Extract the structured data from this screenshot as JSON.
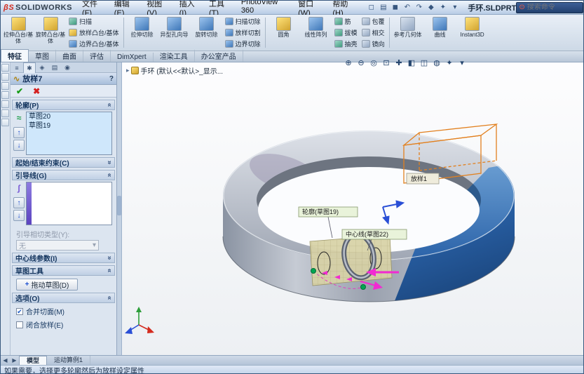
{
  "titlebar": {
    "logo": "SOLIDWORKS",
    "menus": [
      "文件(F)",
      "编辑(E)",
      "视图(V)",
      "插入(I)",
      "工具(T)",
      "PhotoView 360",
      "窗口(W)",
      "帮助(H)"
    ],
    "doc_title": "手环.SLDPRT",
    "search_placeholder": "搜索命令"
  },
  "ribbon": {
    "group1_large": [
      "拉伸凸台/基体",
      "旋转凸台/基体"
    ],
    "group1_stack": [
      "扫描",
      "放样凸台/基体",
      "边界凸台/基体"
    ],
    "group2_large": [
      "拉伸切除",
      "异型孔向导",
      "旋转切除"
    ],
    "group2_stack": [
      "扫描切除",
      "放样切割",
      "边界切除"
    ],
    "group3_large": [
      "圆角",
      "线性阵列"
    ],
    "group3_stack_a": [
      "筋",
      "拔模",
      "抽壳"
    ],
    "group3_stack_b": [
      "包覆",
      "相交",
      "镜向"
    ],
    "group4_large": [
      "参考几何体",
      "曲线",
      "Instant3D"
    ]
  },
  "tab_bar": {
    "tabs": [
      "特征",
      "草图",
      "曲面",
      "评估",
      "DimXpert",
      "渲染工具",
      "办公室产品"
    ]
  },
  "flyout_tree": {
    "label": "手环 (默认<<默认>_显示..."
  },
  "panel": {
    "title": "放样7",
    "help": "?",
    "profiles_header": "轮廓(P)",
    "profiles_items": [
      "草图20",
      "草图19"
    ],
    "constraints_header": "起始/结束约束(C)",
    "guides_header": "引导线(G)",
    "tangency_label": "引导相切类型(Y):",
    "tangency_value": "无",
    "centerline_header": "中心线参数(I)",
    "sketchtools_header": "草图工具",
    "drag_button": "拖动草图(D)",
    "options_header": "选项(O)",
    "opt_merge": "合并切面(M)",
    "opt_close": "闭合放样(E)"
  },
  "viewport": {
    "label_loft": "放样1",
    "label_profile": "轮廓(草图19)",
    "label_centerline": "中心线(草图22)"
  },
  "bottom_bar": {
    "tabs": [
      "模型",
      "运动算例1"
    ]
  },
  "status": {
    "message": "如果需要，选择更多轮廓然后为放样设定属性"
  },
  "icons": {
    "logo_mark": "βS",
    "search": "⊙",
    "quick_access": [
      "◻",
      "▤",
      "◼",
      "↶",
      "↷",
      "◆",
      "✦",
      "▾"
    ],
    "headsup": [
      "⊕",
      "⊖",
      "◎",
      "⊡",
      "✚",
      "◧",
      "◫",
      "◍",
      "✦",
      "▾"
    ],
    "pm_tabs": [
      "≡",
      "✱",
      "◈",
      "▤",
      "◉"
    ],
    "check": "✔",
    "cancel": "✖",
    "up": "↑",
    "down": "↓",
    "chevron_up": "«",
    "chevron_down": "»",
    "dropdown": "▾",
    "loft_glyph": "∿",
    "profiles_glyph": "≈",
    "guides_glyph": "∫",
    "drag_glyph": "+",
    "flyout_arrow": "▸",
    "accent_blue": "#2a62a8",
    "band_gray": "#9aa1ae",
    "highlight_orange": "#e2801f",
    "selection_magenta": "#f22ad2",
    "point_green": "#00a651"
  }
}
